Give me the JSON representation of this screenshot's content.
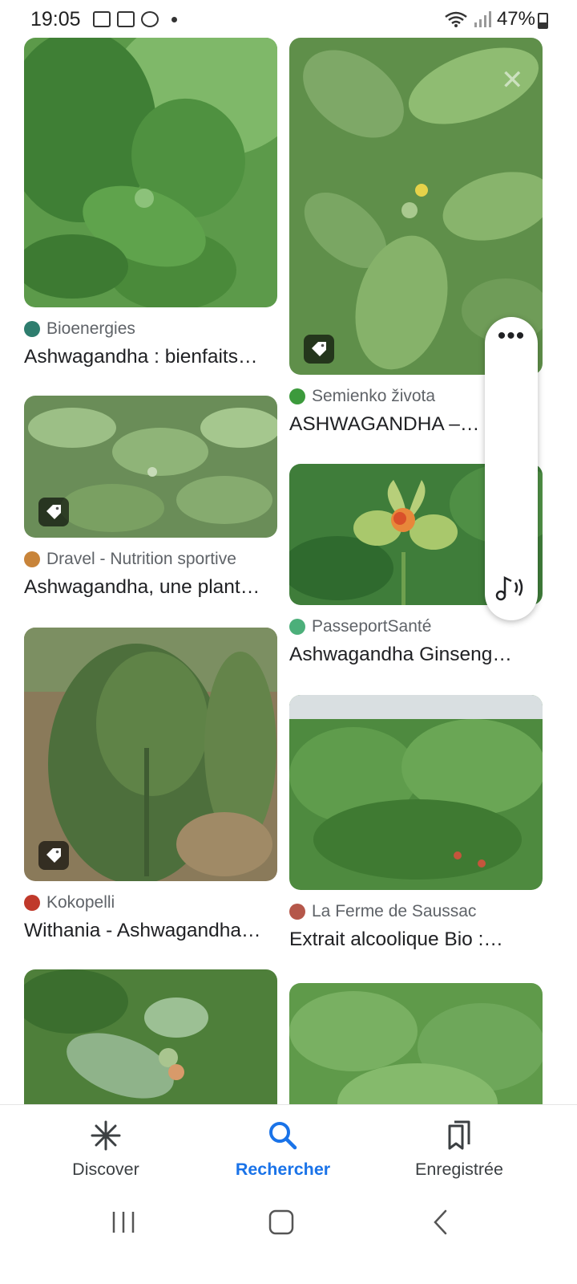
{
  "status_bar": {
    "time": "19:05",
    "battery": "47%",
    "left_icons": [
      "image-icon",
      "voicemail-icon",
      "chrome-icon",
      "dot-icon"
    ],
    "right_icons": [
      "wifi-icon",
      "signal-icon",
      "battery-icon"
    ]
  },
  "results": [
    {
      "source": "Bioenergies",
      "title": "Ashwagandha : bienfaits…",
      "favicon_color": "#2e7d6e",
      "tagged": false
    },
    {
      "source": "Semienko života",
      "title": "ASHWAGANDHA –…",
      "favicon_color": "#3c9a3c",
      "tagged": true
    },
    {
      "source": "Dravel - Nutrition sportive",
      "title": "Ashwagandha, une plant…",
      "favicon_color": "#c8843a",
      "tagged": true
    },
    {
      "source": "PasseportSanté",
      "title": "Ashwagandha Ginseng…",
      "favicon_color": "#4caf7a",
      "tagged": false
    },
    {
      "source": "Kokopelli",
      "title": "Withania - Ashwagandha…",
      "favicon_color": "#c0392b",
      "tagged": true
    },
    {
      "source": "La Ferme de Saussac",
      "title": "Extrait alcoolique Bio :…",
      "favicon_color": "#b5574a",
      "tagged": false
    },
    {
      "source": "",
      "title": "",
      "favicon_color": "",
      "tagged": false
    },
    {
      "source": "",
      "title": "",
      "favicon_color": "",
      "tagged": false
    }
  ],
  "floating_bar": {
    "more_icon": "more-horizontal-icon",
    "audio_icon": "music-sound-icon"
  },
  "bottom_nav": {
    "items": [
      {
        "label": "Discover",
        "icon": "asterisk-icon",
        "active": false
      },
      {
        "label": "Rechercher",
        "icon": "search-icon",
        "active": true
      },
      {
        "label": "Enregistrée",
        "icon": "bookmarks-icon",
        "active": false
      }
    ]
  },
  "colors": {
    "accent": "#1a73e8",
    "source_text": "#5f6368",
    "title_text": "#202124"
  }
}
